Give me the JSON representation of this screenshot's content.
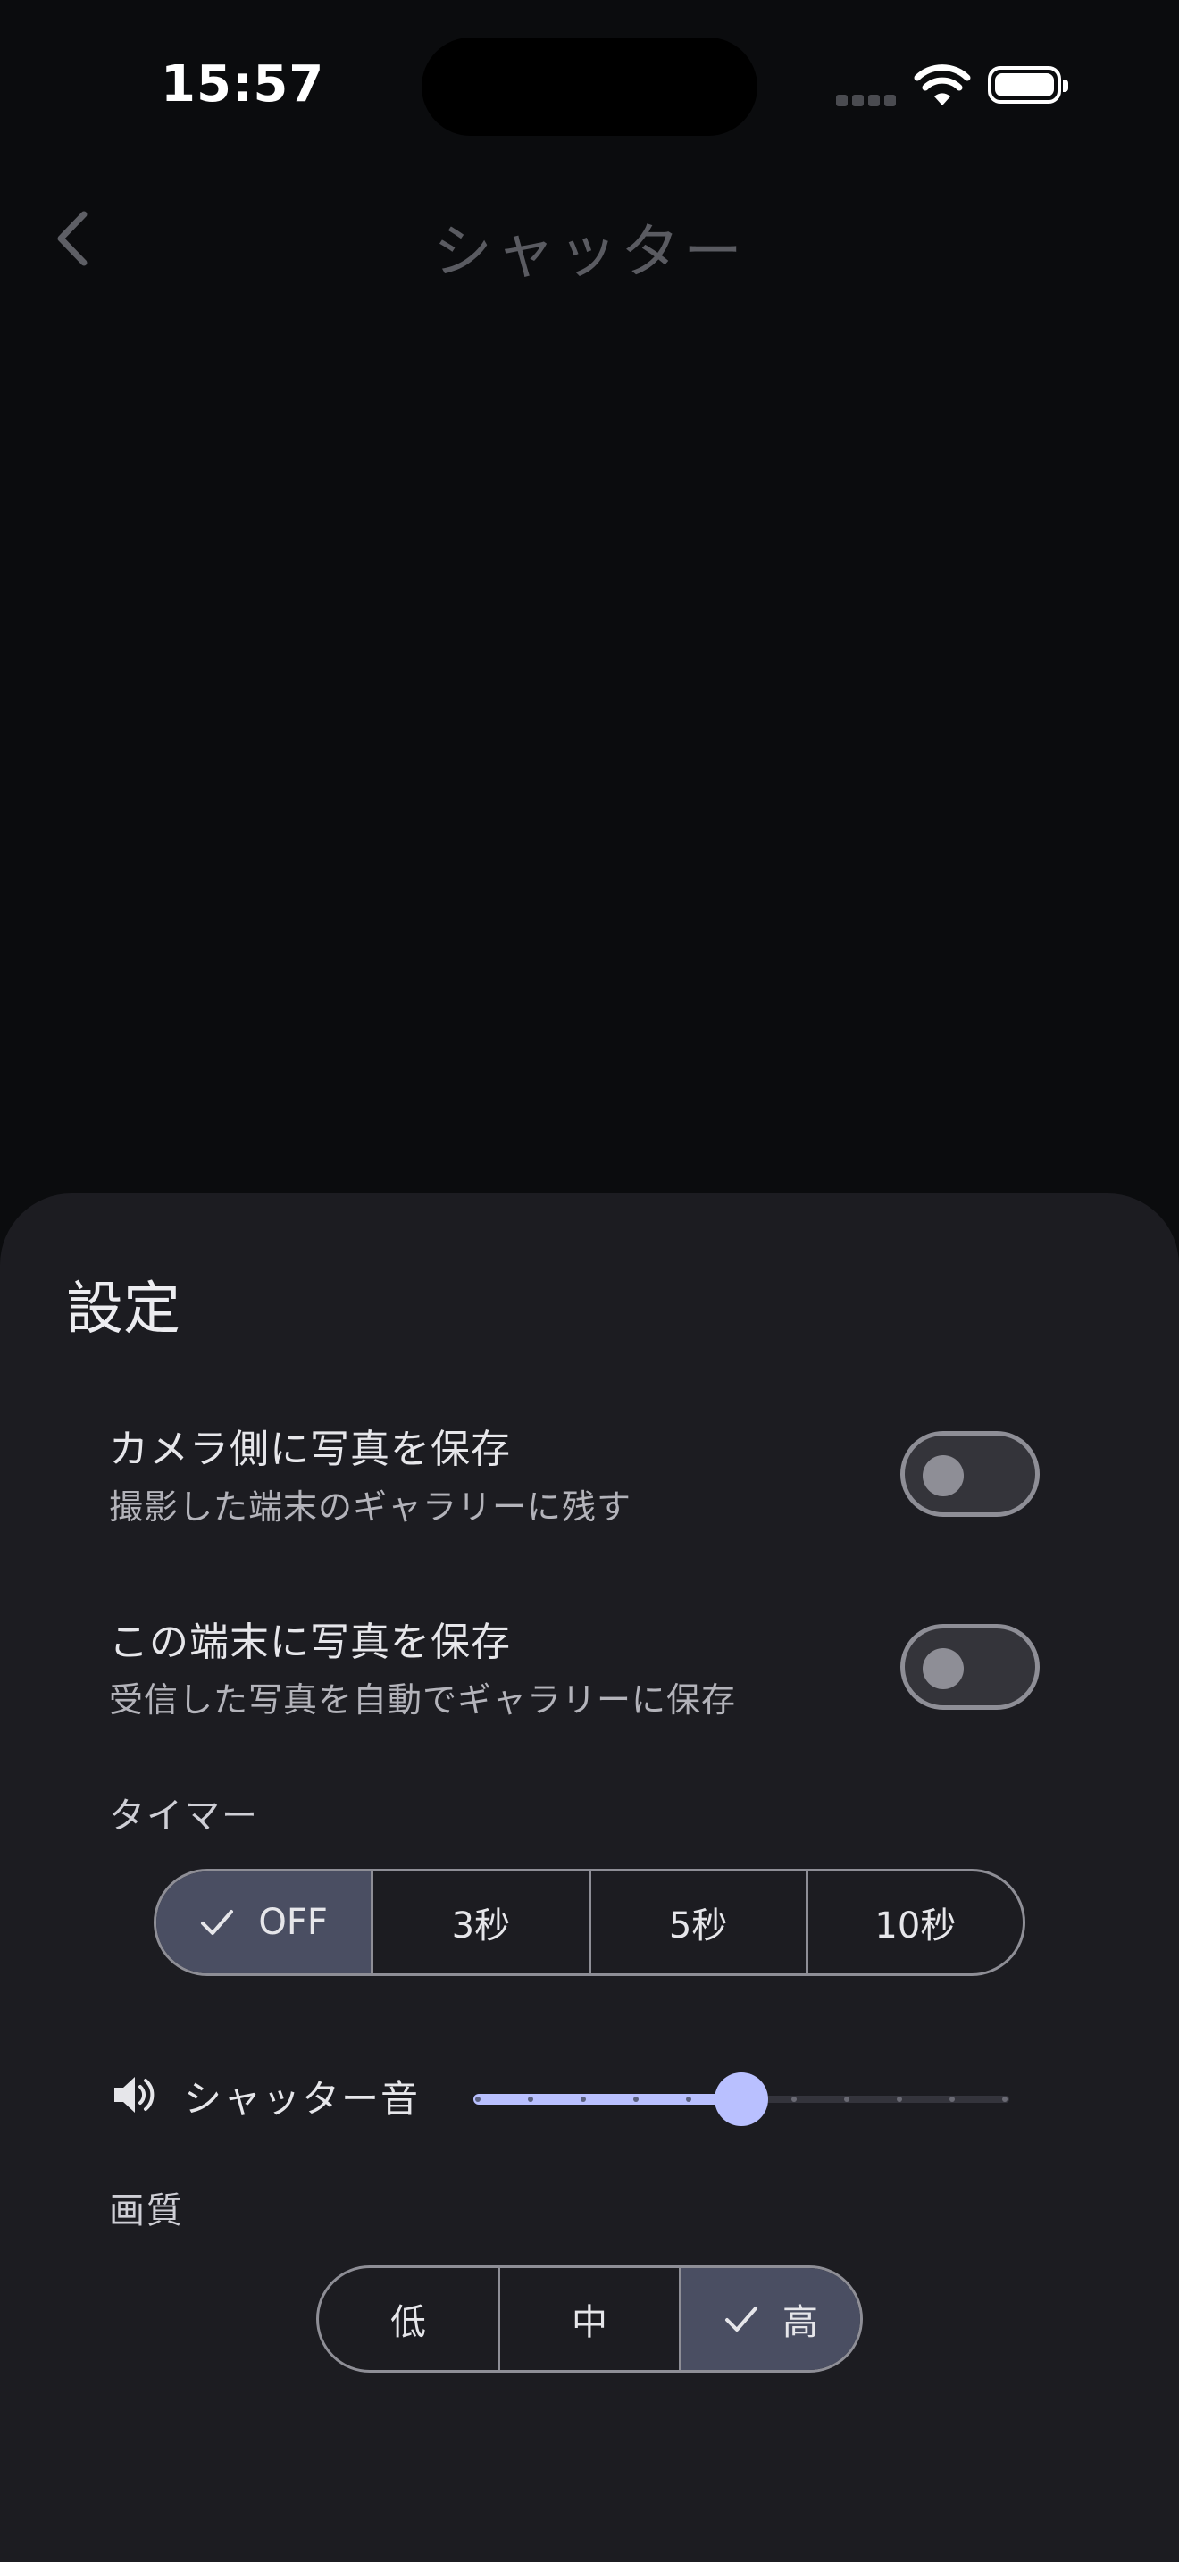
{
  "status_bar": {
    "time": "15:57",
    "battery_icon": "battery-full-icon",
    "wifi_icon": "wifi-icon",
    "signal_icon": "signal-dots-icon"
  },
  "nav": {
    "title": "シャッター",
    "back_icon": "chevron-left-icon"
  },
  "sheet": {
    "title": "設定",
    "camera_save": {
      "title": "カメラ側に写真を保存",
      "subtitle": "撮影した端末のギャラリーに残す",
      "enabled": false
    },
    "device_save": {
      "title": "この端末に写真を保存",
      "subtitle": "受信した写真を自動でギャラリーに保存",
      "enabled": false
    },
    "timer": {
      "label": "タイマー",
      "options": [
        "OFF",
        "3秒",
        "5秒",
        "10秒"
      ],
      "selected": "OFF"
    },
    "shutter_sound": {
      "label": "シャッター音",
      "level_percent": 50,
      "icon": "speaker-icon"
    },
    "quality": {
      "label": "画質",
      "options": [
        "低",
        "中",
        "高"
      ],
      "selected": "高"
    }
  },
  "colors": {
    "accent": "#b9c0ff",
    "selected_segment": "#4a4e62",
    "sheet_bg": "#1c1c21"
  }
}
